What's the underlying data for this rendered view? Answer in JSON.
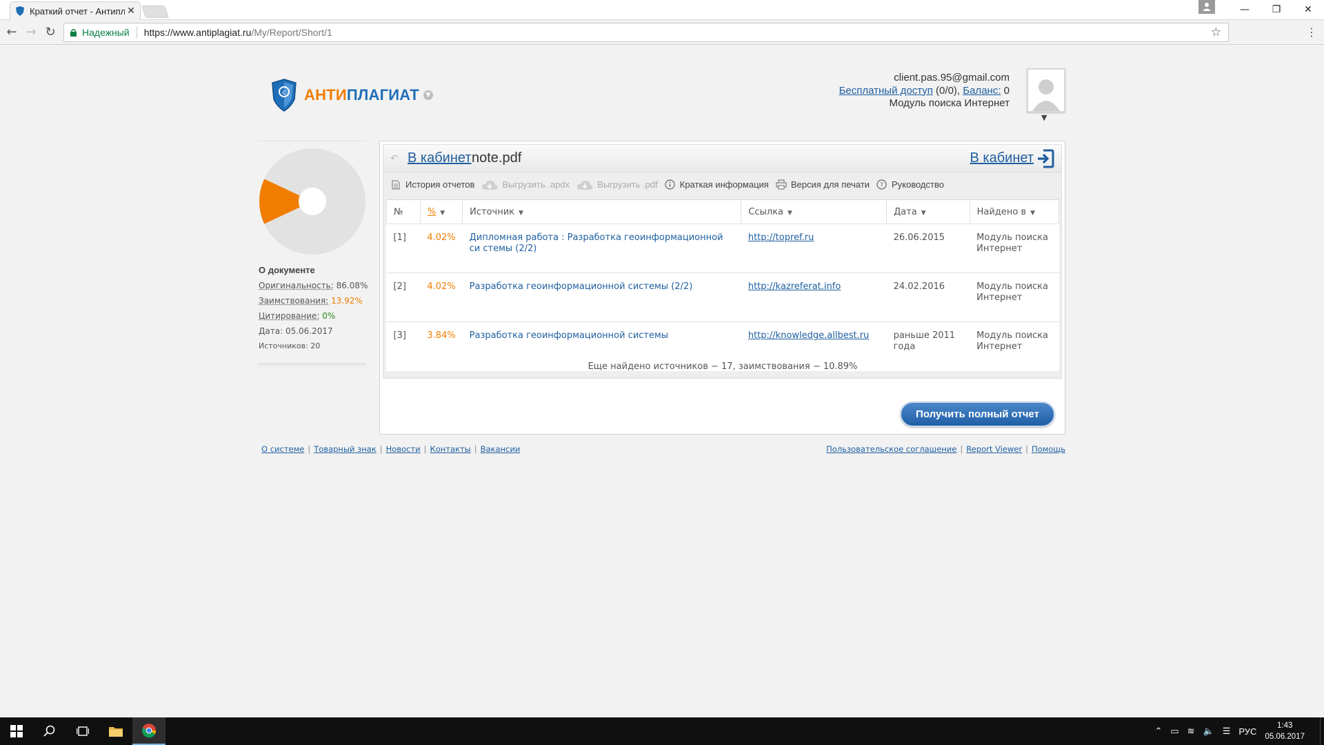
{
  "browser": {
    "tab_title": "Краткий отчет - Антипл",
    "tab_close": "✕",
    "secure_label": "Надежный",
    "url_host": "https://www.antiplagiat.ru",
    "url_path": "/My/Report/Short/1"
  },
  "header": {
    "brand_part1": "АНТИ",
    "brand_part2": "ПЛАГИАТ",
    "email": "client.pas.95@gmail.com",
    "free_access_link": "Бесплатный доступ",
    "free_access_count": " (0/0), ",
    "balance_link": "Баланс:",
    "balance_value": " 0",
    "module": "Модуль поиска Интернет"
  },
  "sidebar": {
    "about_title": "О документе",
    "originality_label": "Оригинальность:",
    "originality_value": "86.08%",
    "borrowing_label": "Заимствования:",
    "borrowing_value": "13.92%",
    "citation_label": "Цитирование:",
    "citation_value": "0%",
    "date_label": "Дата:",
    "date_value": "05.06.2017",
    "sources_label": "Источников:",
    "sources_value": "20"
  },
  "chart_data": {
    "type": "pie",
    "categories": [
      "Оригинальность",
      "Заимствования",
      "Цитирование"
    ],
    "values": [
      86.08,
      13.92,
      0
    ],
    "colors": [
      "#e2e2e2",
      "#f07d00",
      "#2e8b1e"
    ]
  },
  "report": {
    "cabinet_link": "В кабинет",
    "filename": "note.pdf",
    "cabinet_link_right": "В кабинет",
    "actions": {
      "history": "История отчетов",
      "export_apdx": "Выгрузить .apdx",
      "export_pdf": "Выгрузить .pdf",
      "brief_info": "Краткая информация",
      "print_version": "Версия для печати",
      "guide": "Руководство"
    },
    "columns": {
      "num": "№",
      "percent": "%",
      "source": "Источник",
      "link": "Ссылка",
      "date": "Дата",
      "found_in": "Найдено в"
    },
    "rows": [
      {
        "num": "[1]",
        "percent": "4.02%",
        "source": "Дипломная работа : Разработка геоинформационной си стемы (2/2)",
        "link": "http://topref.ru",
        "date": "26.06.2015",
        "found_in": "Модуль поиска Интернет"
      },
      {
        "num": "[2]",
        "percent": "4.02%",
        "source": "Разработка геоинформационной системы (2/2)",
        "link": "http://kazreferat.info",
        "date": "24.02.2016",
        "found_in": "Модуль поиска Интернет"
      },
      {
        "num": "[3]",
        "percent": "3.84%",
        "source": "Разработка геоинформационной системы",
        "link": "http://knowledge.allbest.ru",
        "date": "раньше 2011 года",
        "found_in": "Модуль поиска Интернет"
      }
    ],
    "more_sources": "Еще найдено источников − 17, заимствования − 10.89%",
    "full_report_button": "Получить полный отчет"
  },
  "footer": {
    "left": [
      "О системе",
      "Товарный знак",
      "Новости",
      "Контакты",
      "Вакансии"
    ],
    "right": [
      "Пользовательское соглашение",
      "Report Viewer",
      "Помощь"
    ]
  },
  "taskbar": {
    "lang": "РУС",
    "time": "1:43",
    "date": "05.06.2017"
  }
}
